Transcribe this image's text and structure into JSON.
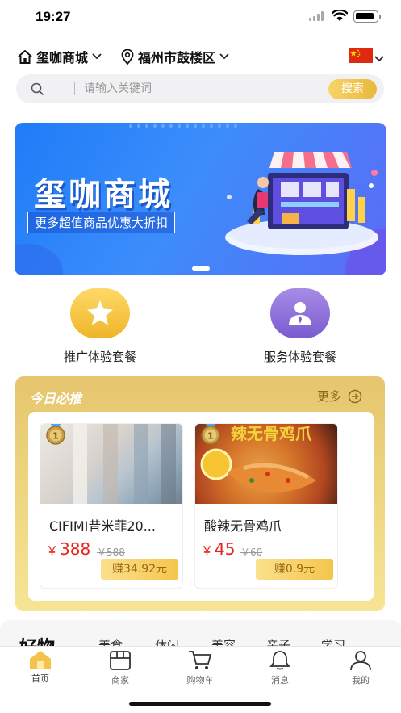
{
  "status_bar": {
    "time": "19:27"
  },
  "top_nav": {
    "shop_name": "玺咖商城",
    "location": "福州市鼓楼区",
    "language_flag": "china-flag"
  },
  "search": {
    "placeholder": "请输入关键词",
    "button_label": "搜索"
  },
  "banner": {
    "title": "玺咖商城",
    "subtitle": "更多超值商品优惠大折扣"
  },
  "categories": [
    {
      "label": "推广体验套餐",
      "icon": "star-icon",
      "color": "#f4c53f"
    },
    {
      "label": "服务体验套餐",
      "icon": "user-icon",
      "color": "#8d6fd8"
    }
  ],
  "today": {
    "title": "今日必推",
    "more_label": "更多",
    "products": [
      {
        "name": "CIFIMI昔米菲20...",
        "currency": "￥",
        "price": "388",
        "original_price": "￥588",
        "earn": "赚34.92元",
        "image_text": ""
      },
      {
        "name": "酸辣无骨鸡爪",
        "currency": "￥",
        "price": "45",
        "original_price": "￥60",
        "earn": "赚0.9元",
        "image_text": "辣无骨鸡爪"
      }
    ]
  },
  "feed_tabs": [
    "好物",
    "美食",
    "休闲",
    "美容",
    "亲子",
    "学习"
  ],
  "bottom_nav": [
    {
      "label": "首页",
      "icon": "home-icon",
      "active": true
    },
    {
      "label": "商家",
      "icon": "store-icon",
      "active": false
    },
    {
      "label": "购物车",
      "icon": "cart-icon",
      "active": false
    },
    {
      "label": "消息",
      "icon": "bell-icon",
      "active": false
    },
    {
      "label": "我的",
      "icon": "profile-icon",
      "active": false
    }
  ],
  "colors": {
    "accent_gold": "#efb529",
    "price_red": "#e8231c",
    "banner_blue": "#1f7cf7"
  }
}
